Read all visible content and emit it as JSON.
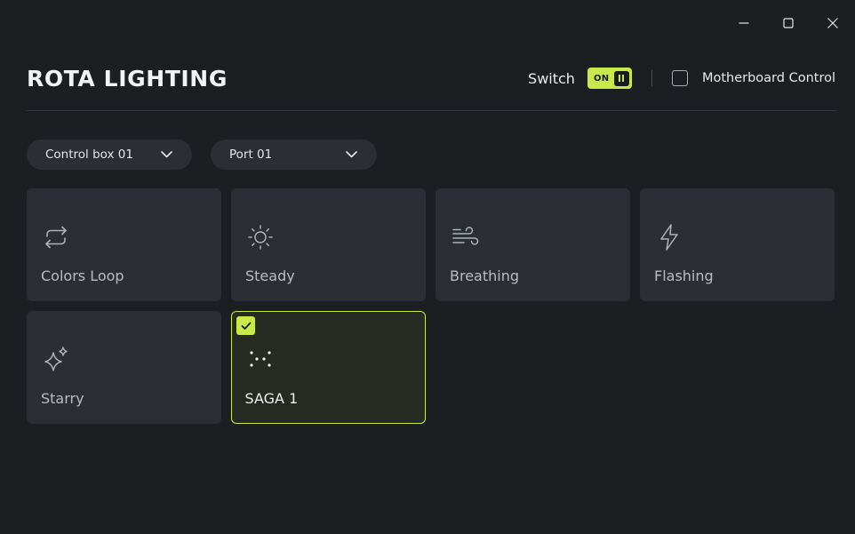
{
  "app": {
    "title": "ROTA LIGHTING"
  },
  "window_controls": [
    "minimize-icon",
    "maximize-icon",
    "close-icon"
  ],
  "header": {
    "switch_label": "Switch",
    "switch_state": "ON",
    "motherboard_label": "Motherboard Control",
    "motherboard_checked": false
  },
  "selectors": {
    "control_box": "Control box 01",
    "port": "Port 01"
  },
  "effects": [
    {
      "label": "Colors Loop",
      "icon": "loop-arrows-icon",
      "selected": false
    },
    {
      "label": "Steady",
      "icon": "sun-icon",
      "selected": false
    },
    {
      "label": "Breathing",
      "icon": "wind-icon",
      "selected": false
    },
    {
      "label": "Flashing",
      "icon": "lightning-icon",
      "selected": false
    },
    {
      "label": "Starry",
      "icon": "sparkles-icon",
      "selected": false
    },
    {
      "label": "SAGA 1",
      "icon": "dots-pattern-icon",
      "selected": true
    }
  ],
  "colors": {
    "accent": "#c9e84a",
    "background": "#1c1e22",
    "tile": "#2b2e34"
  }
}
